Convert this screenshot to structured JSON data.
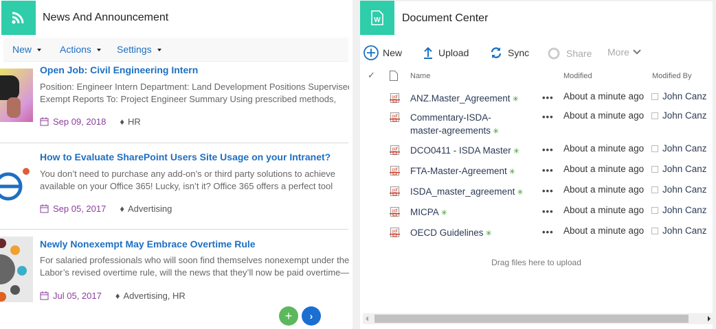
{
  "news": {
    "title": "News And Announcement",
    "icon": "rss-icon",
    "toolbar": [
      "New",
      "Actions",
      "Settings"
    ],
    "items": [
      {
        "title": "Open Job: Civil Engineering Intern",
        "excerpt": [
          "Position: Engineer Intern Department: Land Development Positions Supervised",
          "Exempt Reports To: Project Engineer Summary Using prescribed methods,"
        ],
        "date": "Sep 09, 2018",
        "tags": "HR"
      },
      {
        "title": "How to Evaluate SharePoint Users Site Usage on your Intranet?",
        "excerpt": [
          "You don’t need to purchase any add-on’s or third party solutions to achieve",
          "available on your Office 365! Lucky, isn’t it? Office 365 offers a perfect tool"
        ],
        "date": "Sep 05, 2017",
        "tags": "Advertising"
      },
      {
        "title": "Newly Nonexempt May Embrace Overtime Rule",
        "excerpt": [
          "For salaried professionals who will soon find themselves nonexempt under the",
          "Labor’s revised overtime rule, will the news that they’ll now be paid overtime—"
        ],
        "date": "Jul 05, 2017",
        "tags": "Advertising, HR"
      }
    ],
    "colors": {
      "accent": "#2fcdaa",
      "link": "#1e6fc2",
      "date": "#8b3e9c",
      "add": "#5cb85c",
      "next": "#1a6fd1"
    }
  },
  "docs": {
    "title": "Document Center",
    "icon": "word-document-icon",
    "toolbar": {
      "new": "New",
      "upload": "Upload",
      "sync": "Sync",
      "share": "Share",
      "more": "More"
    },
    "columns": {
      "name": "Name",
      "modified": "Modified",
      "modified_by": "Modified By"
    },
    "files": [
      {
        "name": "ANZ.Master_Agreement",
        "modified": "About a minute ago",
        "by": "John Canz"
      },
      {
        "name": "Commentary-ISDA-master-agreements",
        "modified": "About a minute ago",
        "by": "John Canz"
      },
      {
        "name": "DCO0411 - ISDA Master",
        "modified": "About a minute ago",
        "by": "John Canz"
      },
      {
        "name": "FTA-Master-Agreement",
        "modified": "About a minute ago",
        "by": "John Canz"
      },
      {
        "name": "ISDA_master_agreement",
        "modified": "About a minute ago",
        "by": "John Canz"
      },
      {
        "name": "MICPA",
        "modified": "About a minute ago",
        "by": "John Canz"
      },
      {
        "name": "OECD Guidelines",
        "modified": "About a minute ago",
        "by": "John Canz"
      }
    ],
    "drag_hint": "Drag files here to upload"
  }
}
